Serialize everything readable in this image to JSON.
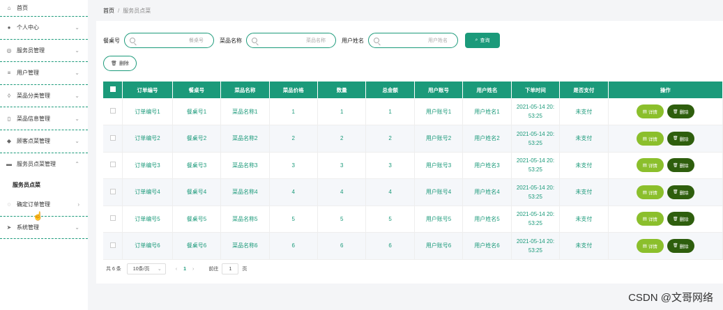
{
  "sidebar": {
    "items": [
      {
        "label": "首页",
        "icon": "home-icon",
        "glyph": "⌂",
        "chev": ""
      },
      {
        "label": "个人中心",
        "icon": "user-icon",
        "glyph": "●",
        "chev": "⌄"
      },
      {
        "label": "服务员管理",
        "icon": "globe-icon",
        "glyph": "◎",
        "chev": "⌄"
      },
      {
        "label": "用户管理",
        "icon": "list-icon",
        "glyph": "≡",
        "chev": "⌄"
      },
      {
        "label": "菜品分类管理",
        "icon": "mic-icon",
        "glyph": "◊",
        "chev": "⌄"
      },
      {
        "label": "菜品信息管理",
        "icon": "phone-icon",
        "glyph": "▯",
        "chev": "⌄"
      },
      {
        "label": "顾客点菜管理",
        "icon": "thumb-icon",
        "glyph": "◆",
        "chev": "⌄"
      },
      {
        "label": "服务员点菜管理",
        "icon": "briefcase-icon",
        "glyph": "▬",
        "chev": "⌃"
      }
    ],
    "sub_item": "服务员点菜",
    "items_after": [
      {
        "label": "确定订单管理",
        "icon": "circle-icon",
        "glyph": "◌",
        "chev": "›"
      },
      {
        "label": "系统管理",
        "icon": "send-icon",
        "glyph": "➤",
        "chev": "⌄"
      }
    ]
  },
  "breadcrumb": {
    "home": "首页",
    "sep": "/",
    "current": "服务员点菜"
  },
  "search": {
    "table_label": "餐桌号",
    "table_placeholder": "餐桌号",
    "dish_label": "菜品名称",
    "dish_placeholder": "菜品名称",
    "user_label": "用户姓名",
    "user_placeholder": "用户姓名",
    "query_label": "查询"
  },
  "delete_label": "删除",
  "table": {
    "headers": [
      "订单编号",
      "餐桌号",
      "菜品名称",
      "菜品价格",
      "数量",
      "总金额",
      "用户账号",
      "用户姓名",
      "下单时间",
      "是否支付",
      "操作"
    ],
    "rows": [
      {
        "c0": "订单编号1",
        "c1": "餐桌号1",
        "c2": "菜品名称1",
        "c3": "1",
        "c4": "1",
        "c5": "1",
        "c6": "用户账号1",
        "c7": "用户姓名1",
        "c8a": "2021-05-14 20:",
        "c8b": "53:25",
        "c9": "未支付"
      },
      {
        "c0": "订单编号2",
        "c1": "餐桌号2",
        "c2": "菜品名称2",
        "c3": "2",
        "c4": "2",
        "c5": "2",
        "c6": "用户账号2",
        "c7": "用户姓名2",
        "c8a": "2021-05-14 20:",
        "c8b": "53:25",
        "c9": "未支付"
      },
      {
        "c0": "订单编号3",
        "c1": "餐桌号3",
        "c2": "菜品名称3",
        "c3": "3",
        "c4": "3",
        "c5": "3",
        "c6": "用户账号3",
        "c7": "用户姓名3",
        "c8a": "2021-05-14 20:",
        "c8b": "53:25",
        "c9": "未支付"
      },
      {
        "c0": "订单编号4",
        "c1": "餐桌号4",
        "c2": "菜品名称4",
        "c3": "4",
        "c4": "4",
        "c5": "4",
        "c6": "用户账号4",
        "c7": "用户姓名4",
        "c8a": "2021-05-14 20:",
        "c8b": "53:25",
        "c9": "未支付"
      },
      {
        "c0": "订单编号5",
        "c1": "餐桌号5",
        "c2": "菜品名称5",
        "c3": "5",
        "c4": "5",
        "c5": "5",
        "c6": "用户账号5",
        "c7": "用户姓名5",
        "c8a": "2021-05-14 20:",
        "c8b": "53:25",
        "c9": "未支付"
      },
      {
        "c0": "订单编号6",
        "c1": "餐桌号6",
        "c2": "菜品名称6",
        "c3": "6",
        "c4": "6",
        "c5": "6",
        "c6": "用户账号6",
        "c7": "用户姓名6",
        "c8a": "2021-05-14 20:",
        "c8b": "53:25",
        "c9": "未支付"
      }
    ],
    "detail_label": "详情",
    "row_delete_label": "删除"
  },
  "pager": {
    "total": "共 6 条",
    "page_size": "10条/页",
    "prev": "‹",
    "page": "1",
    "next": "›",
    "goto": "前往",
    "goto_value": "1",
    "page_unit": "页"
  },
  "watermark": "CSDN @文哥网络",
  "colors": {
    "accent": "#1b9a7a",
    "detail": "#8bbf2c",
    "delete": "#2e5e0d"
  }
}
